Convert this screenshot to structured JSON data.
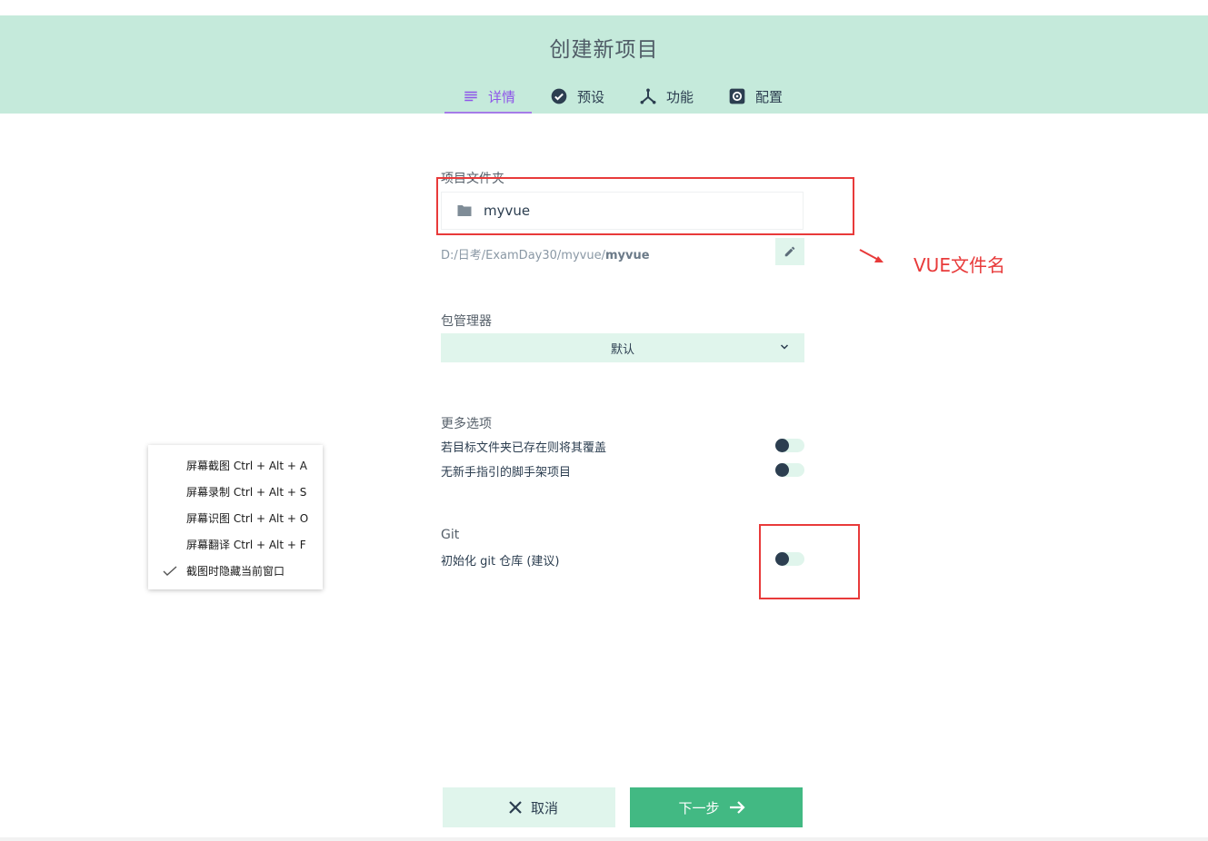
{
  "header": {
    "title": "创建新项目",
    "tabs": [
      {
        "label": "详情",
        "icon": "list-icon",
        "active": true
      },
      {
        "label": "预设",
        "icon": "check-circle-icon",
        "active": false
      },
      {
        "label": "功能",
        "icon": "call-split-icon",
        "active": false
      },
      {
        "label": "配置",
        "icon": "settings-icon",
        "active": false
      }
    ]
  },
  "details": {
    "folder_label": "项目文件夹",
    "folder_value": "myvue",
    "path_prefix": "D:/日考/ExamDay30/myvue/",
    "path_name": "myvue",
    "package_manager_label": "包管理器",
    "package_manager_value": "默认",
    "more_options_label": "更多选项",
    "options": [
      {
        "label": "若目标文件夹已存在则将其覆盖",
        "enabled": false
      },
      {
        "label": "无新手指引的脚手架项目",
        "enabled": false
      }
    ],
    "git_label": "Git",
    "git_option": {
      "label": "初始化 git 仓库 (建议)",
      "enabled": false
    }
  },
  "annotation": {
    "text": "VUE文件名",
    "color": "#e83a3a"
  },
  "context_menu": {
    "items": [
      {
        "label": "屏幕截图 Ctrl + Alt + A",
        "checked": false
      },
      {
        "label": "屏幕录制 Ctrl + Alt + S",
        "checked": false
      },
      {
        "label": "屏幕识图 Ctrl + Alt + O",
        "checked": false
      },
      {
        "label": "屏幕翻译 Ctrl + Alt + F",
        "checked": false
      },
      {
        "label": "截图时隐藏当前窗口",
        "checked": true
      }
    ]
  },
  "footer": {
    "cancel_label": "取消",
    "next_label": "下一步"
  },
  "colors": {
    "header_bg": "#c5eadb",
    "accent": "#42b983",
    "active_tab": "#8e54e9",
    "light_green": "#e0f5ec"
  }
}
